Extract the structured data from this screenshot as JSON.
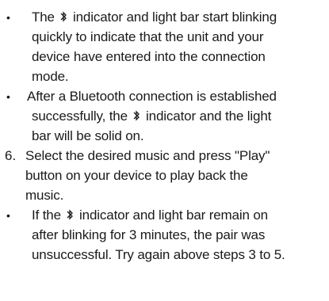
{
  "instructions": [
    {
      "marker": "•",
      "lines": [
        [
          "The ",
          "{bt}",
          " indicator and light bar start blinking"
        ],
        [
          "quickly to indicate that the unit and your"
        ],
        [
          "device have entered  into  the connection"
        ],
        [
          "mode."
        ]
      ]
    },
    {
      "marker": "•",
      "lines": [
        [
          "After a Bluetooth connection is established"
        ],
        [
          "successfully, the ",
          "{bt}",
          " indicator and the light"
        ],
        [
          "bar will be solid on."
        ]
      ]
    },
    {
      "marker": "6.",
      "lines": [
        [
          "Select the desired music and press \"Play\""
        ],
        [
          "button on your device to play back the"
        ],
        [
          "music."
        ]
      ]
    },
    {
      "marker": "•",
      "lines": [
        [
          "If the ",
          "{bt}",
          " indicator and light bar remain on"
        ],
        [
          "after blinking for 3 minutes, the pair was"
        ],
        [
          "unsuccessful. Try again above steps 3 to 5."
        ]
      ]
    }
  ],
  "icons": {
    "bluetooth": "bluetooth-icon"
  }
}
